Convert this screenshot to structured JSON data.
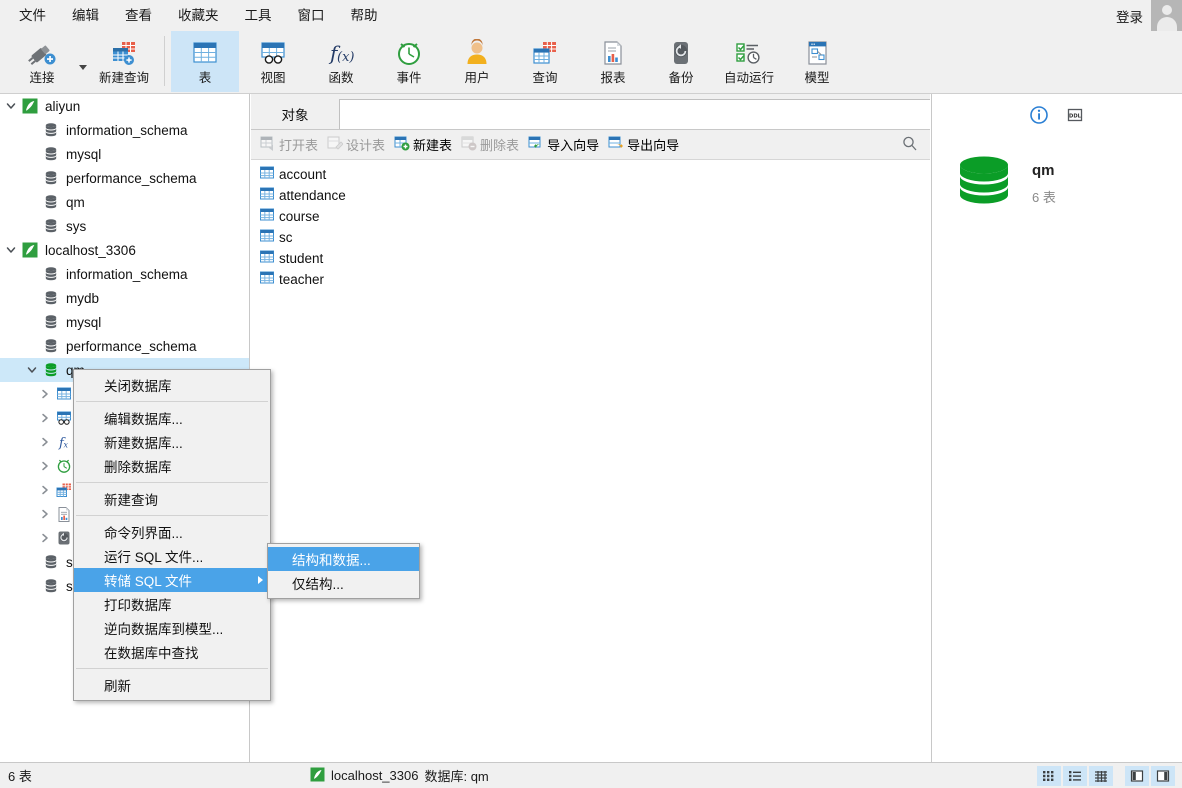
{
  "menubar": {
    "items": [
      {
        "label": "文件"
      },
      {
        "label": "编辑"
      },
      {
        "label": "查看"
      },
      {
        "label": "收藏夹"
      },
      {
        "label": "工具"
      },
      {
        "label": "窗口"
      },
      {
        "label": "帮助"
      }
    ],
    "login_label": "登录"
  },
  "toolbar": {
    "buttons": [
      {
        "label": "连接",
        "icon": "connect-icon",
        "selected": false
      },
      {
        "label": "新建查询",
        "icon": "new-query-icon",
        "selected": false
      },
      {
        "label": "表",
        "icon": "table-icon",
        "selected": true
      },
      {
        "label": "视图",
        "icon": "view-icon",
        "selected": false
      },
      {
        "label": "函数",
        "icon": "function-icon",
        "selected": false
      },
      {
        "label": "事件",
        "icon": "event-icon",
        "selected": false
      },
      {
        "label": "用户",
        "icon": "user-icon",
        "selected": false
      },
      {
        "label": "查询",
        "icon": "query-icon",
        "selected": false
      },
      {
        "label": "报表",
        "icon": "report-icon",
        "selected": false
      },
      {
        "label": "备份",
        "icon": "backup-icon",
        "selected": false
      },
      {
        "label": "自动运行",
        "icon": "automation-icon",
        "selected": false
      },
      {
        "label": "模型",
        "icon": "model-icon",
        "selected": false
      }
    ]
  },
  "sidebar": {
    "nodes": [
      {
        "label": "aliyun",
        "icon": "connection-icon",
        "indent": 0,
        "twisty": "expanded",
        "selected": false
      },
      {
        "label": "information_schema",
        "icon": "database-icon",
        "indent": 1,
        "twisty": "none",
        "selected": false
      },
      {
        "label": "mysql",
        "icon": "database-icon",
        "indent": 1,
        "twisty": "none",
        "selected": false
      },
      {
        "label": "performance_schema",
        "icon": "database-icon",
        "indent": 1,
        "twisty": "none",
        "selected": false
      },
      {
        "label": "qm",
        "icon": "database-icon",
        "indent": 1,
        "twisty": "none",
        "selected": false
      },
      {
        "label": "sys",
        "icon": "database-icon",
        "indent": 1,
        "twisty": "none",
        "selected": false
      },
      {
        "label": "localhost_3306",
        "icon": "connection-icon",
        "indent": 0,
        "twisty": "expanded",
        "selected": false
      },
      {
        "label": "information_schema",
        "icon": "database-icon",
        "indent": 1,
        "twisty": "none",
        "selected": false
      },
      {
        "label": "mydb",
        "icon": "database-icon",
        "indent": 1,
        "twisty": "none",
        "selected": false
      },
      {
        "label": "mysql",
        "icon": "database-icon",
        "indent": 1,
        "twisty": "none",
        "selected": false
      },
      {
        "label": "performance_schema",
        "icon": "database-icon",
        "indent": 1,
        "twisty": "none",
        "selected": false
      },
      {
        "label": "qm",
        "icon": "database-icon-open",
        "indent": 1,
        "twisty": "expanded",
        "selected": true
      },
      {
        "label": "",
        "icon": "table-icon",
        "indent": 2,
        "twisty": "collapsed",
        "selected": false
      },
      {
        "label": "",
        "icon": "view-icon",
        "indent": 2,
        "twisty": "collapsed",
        "selected": false
      },
      {
        "label": "",
        "icon": "function-icon",
        "indent": 2,
        "twisty": "collapsed",
        "selected": false
      },
      {
        "label": "",
        "icon": "event-icon",
        "indent": 2,
        "twisty": "collapsed",
        "selected": false
      },
      {
        "label": "",
        "icon": "query-icon",
        "indent": 2,
        "twisty": "collapsed",
        "selected": false
      },
      {
        "label": "",
        "icon": "report-icon",
        "indent": 2,
        "twisty": "collapsed",
        "selected": false
      },
      {
        "label": "",
        "icon": "backup-icon",
        "indent": 2,
        "twisty": "collapsed",
        "selected": false
      },
      {
        "label": "si",
        "icon": "database-icon",
        "indent": 1,
        "twisty": "none",
        "selected": false
      },
      {
        "label": "sy",
        "icon": "database-icon",
        "indent": 1,
        "twisty": "none",
        "selected": false
      }
    ]
  },
  "center": {
    "tab_label": "对象",
    "objbar": [
      {
        "label": "打开表",
        "icon": "open-table-icon",
        "disabled": true
      },
      {
        "label": "设计表",
        "icon": "design-table-icon",
        "disabled": true
      },
      {
        "label": "新建表",
        "icon": "new-table-icon",
        "disabled": false
      },
      {
        "label": "删除表",
        "icon": "delete-table-icon",
        "disabled": true
      },
      {
        "label": "导入向导",
        "icon": "import-wizard-icon",
        "disabled": false
      },
      {
        "label": "导出向导",
        "icon": "export-wizard-icon",
        "disabled": false
      }
    ],
    "tables": [
      {
        "name": "account"
      },
      {
        "name": "attendance"
      },
      {
        "name": "course"
      },
      {
        "name": "sc"
      },
      {
        "name": "student"
      },
      {
        "name": "teacher"
      }
    ]
  },
  "infopane": {
    "tabs": [
      {
        "icon": "info-icon",
        "active": true
      },
      {
        "icon": "ddl-icon",
        "active": false
      }
    ],
    "db_name": "qm",
    "db_sub": "6 表"
  },
  "contextmenu": {
    "items": [
      {
        "label": "关闭数据库",
        "type": "item"
      },
      {
        "type": "sep"
      },
      {
        "label": "编辑数据库...",
        "type": "item"
      },
      {
        "label": "新建数据库...",
        "type": "item"
      },
      {
        "label": "删除数据库",
        "type": "item"
      },
      {
        "type": "sep"
      },
      {
        "label": "新建查询",
        "type": "item"
      },
      {
        "type": "sep"
      },
      {
        "label": "命令列界面...",
        "type": "item"
      },
      {
        "label": "运行 SQL 文件...",
        "type": "item"
      },
      {
        "label": "转储 SQL 文件",
        "type": "item",
        "highlighted": true,
        "submenu": true
      },
      {
        "label": "打印数据库",
        "type": "item"
      },
      {
        "label": "逆向数据库到模型...",
        "type": "item"
      },
      {
        "label": "在数据库中查找",
        "type": "item"
      },
      {
        "type": "sep"
      },
      {
        "label": "刷新",
        "type": "item"
      }
    ],
    "submenu_items": [
      {
        "label": "结构和数据...",
        "highlighted": true
      },
      {
        "label": "仅结构...",
        "highlighted": false
      }
    ]
  },
  "statusbar": {
    "left": "6 表",
    "connection": "localhost_3306",
    "database": "数据库: qm",
    "view_buttons": [
      {
        "icon": "grid-view-icon",
        "active": true
      },
      {
        "icon": "list-view-icon",
        "active": true
      },
      {
        "icon": "detail-view-icon",
        "active": true
      },
      {
        "icon": "left-panel-icon",
        "active": true
      },
      {
        "icon": "right-panel-icon",
        "active": true
      }
    ]
  },
  "colors": {
    "accent": "#4aa3e8",
    "selection": "#cde8f9",
    "chrome": "#f0f0f0",
    "db_green": "#0b9d27"
  }
}
